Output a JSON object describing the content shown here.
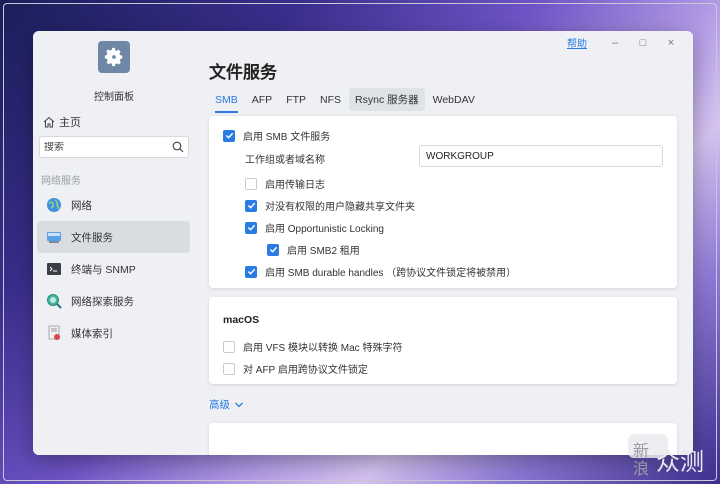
{
  "window": {
    "help_link": "帮助",
    "minimize_glyph": "–",
    "maximize_glyph": "□",
    "close_glyph": "×"
  },
  "sidebar": {
    "app_title": "控制面板",
    "home_label": "主页",
    "search_placeholder": "搜索",
    "group_label": "网络服务",
    "items": [
      {
        "label": "网络",
        "icon": "globe-icon"
      },
      {
        "label": "文件服务",
        "icon": "file-service-icon",
        "active": true
      },
      {
        "label": "终端与 SNMP",
        "icon": "terminal-icon"
      },
      {
        "label": "网络探索服务",
        "icon": "discovery-icon"
      },
      {
        "label": "媒体索引",
        "icon": "media-index-icon"
      }
    ]
  },
  "main": {
    "title": "文件服务",
    "tabs": [
      {
        "label": "SMB",
        "active": true
      },
      {
        "label": "AFP"
      },
      {
        "label": "FTP"
      },
      {
        "label": "NFS"
      },
      {
        "label": "Rsync 服务器",
        "hover": true
      },
      {
        "label": "WebDAV"
      }
    ],
    "smb": {
      "enable_label": "启用 SMB 文件服务",
      "enable_checked": true,
      "workgroup_label": "工作组或者域名称",
      "workgroup_value": "WORKGROUP",
      "options": [
        {
          "label": "启用传输日志",
          "checked": false
        },
        {
          "label": "对没有权限的用户隐藏共享文件夹",
          "checked": true
        },
        {
          "label": "启用 Opportunistic Locking",
          "checked": true
        },
        {
          "label": "启用 SMB2 租用",
          "checked": true
        },
        {
          "label": "启用 SMB durable handles （跨协议文件锁定将被禁用）",
          "checked": true
        }
      ]
    },
    "macos": {
      "heading": "macOS",
      "options": [
        {
          "label": "启用 VFS 模块以转换 Mac 特殊字符",
          "checked": false
        },
        {
          "label": "对 AFP 启用跨协议文件锁定",
          "checked": false
        }
      ]
    },
    "advanced_label": "高级"
  },
  "watermark": {
    "text1": "新",
    "text2": "浪",
    "text3": "众测"
  },
  "colors": {
    "accent": "#2a7be4",
    "sidebar_bg": "#eef0f3",
    "active_item_bg": "#d9dce1"
  }
}
